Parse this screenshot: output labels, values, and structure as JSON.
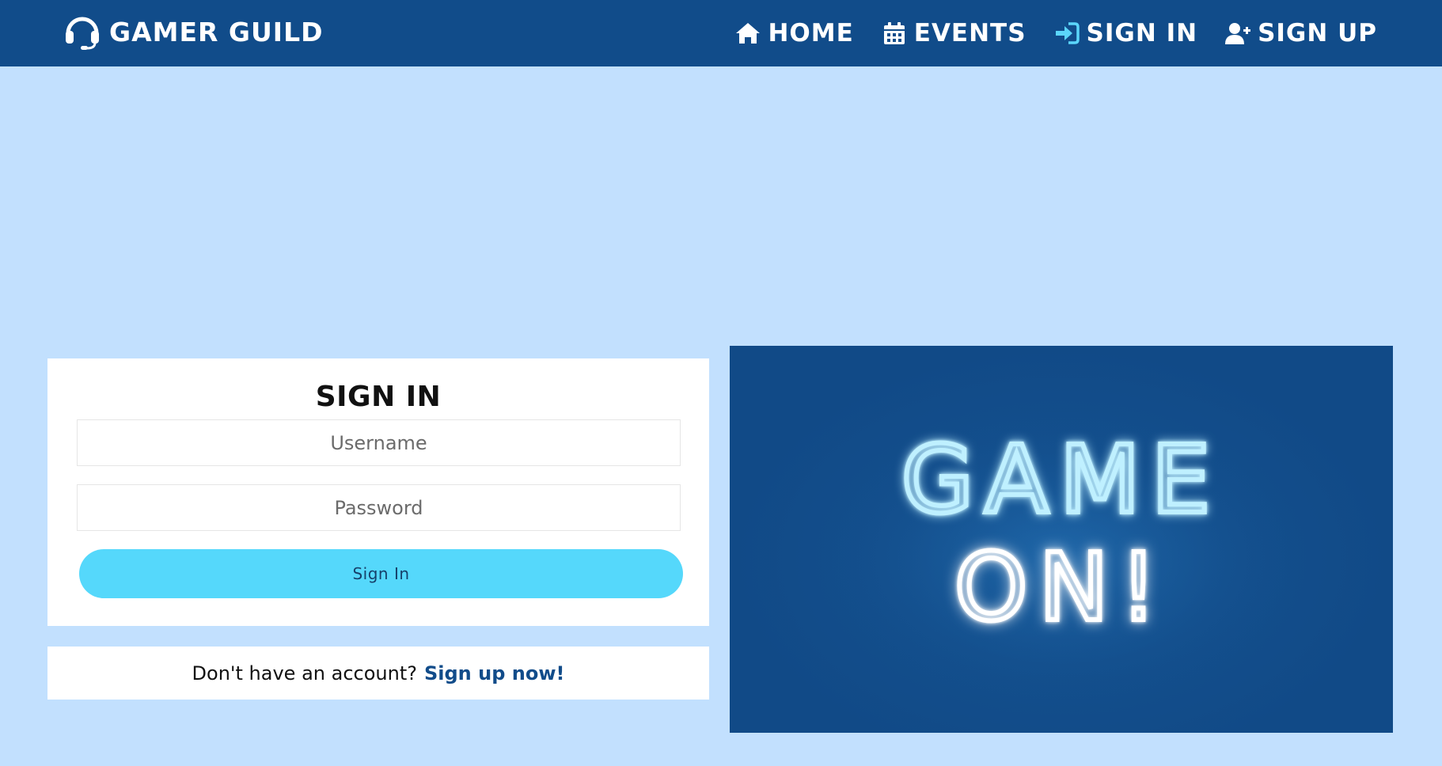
{
  "brand": {
    "name": "GAMER GUILD",
    "icon": "headset-icon"
  },
  "nav": {
    "items": [
      {
        "label": "HOME",
        "icon": "home-icon"
      },
      {
        "label": "EVENTS",
        "icon": "calendar-icon"
      },
      {
        "label": "SIGN IN",
        "icon": "sign-in-icon",
        "active": true
      },
      {
        "label": "SIGN UP",
        "icon": "user-plus-icon"
      }
    ]
  },
  "signin": {
    "title": "SIGN IN",
    "username_placeholder": "Username",
    "password_placeholder": "Password",
    "button_label": "Sign In"
  },
  "signup": {
    "prompt": "Don't have an account?",
    "link_label": "Sign up now!"
  },
  "hero": {
    "line1": "GAME",
    "line2": "ON!"
  },
  "colors": {
    "background": "#c2e0fe",
    "navbar": "#114c8a",
    "accent": "#55d8fb",
    "link": "#114c8a",
    "neon_blue": "#8fe3ff",
    "neon_white": "#ffffff"
  }
}
